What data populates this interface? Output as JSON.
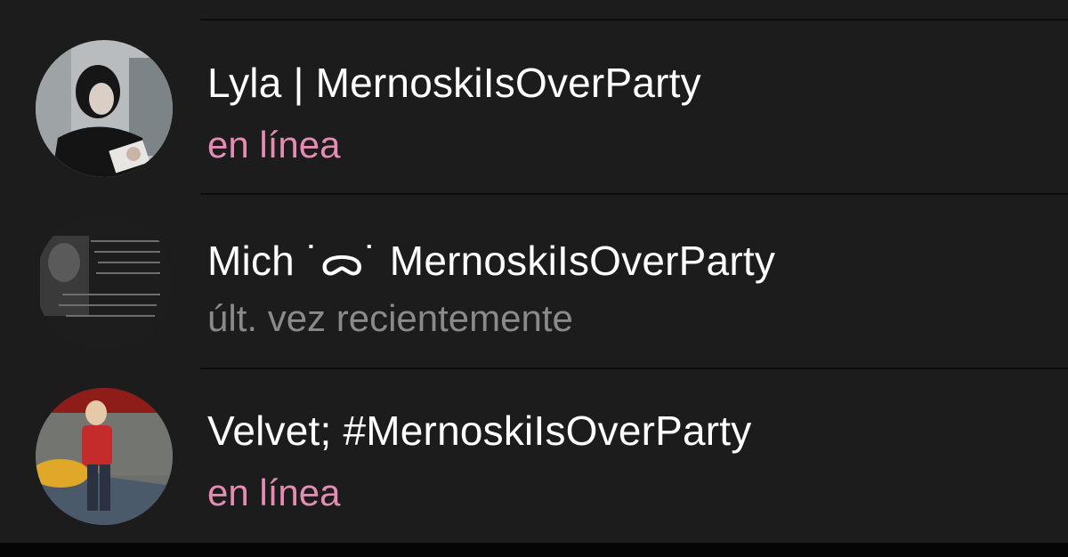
{
  "theme": {
    "background": "#1c1c1c",
    "divider": "#0c0c0c",
    "name_color": "#ffffff",
    "online_color": "#e58bb4",
    "offline_color": "#8a8a8a"
  },
  "contacts": [
    {
      "name": "Lyla | MernoskiIsOverParty",
      "status": "en línea",
      "online": true,
      "avatar": "photo-girl-avatar"
    },
    {
      "name": "Mich ˙ᯅ˙ MernoskiIsOverParty",
      "status": "últ. vez recientemente",
      "online": false,
      "avatar": "text-collage-avatar"
    },
    {
      "name": "Velvet; #MernoskiIsOverParty",
      "status": "en línea",
      "online": true,
      "avatar": "photo-kid-avatar"
    }
  ]
}
